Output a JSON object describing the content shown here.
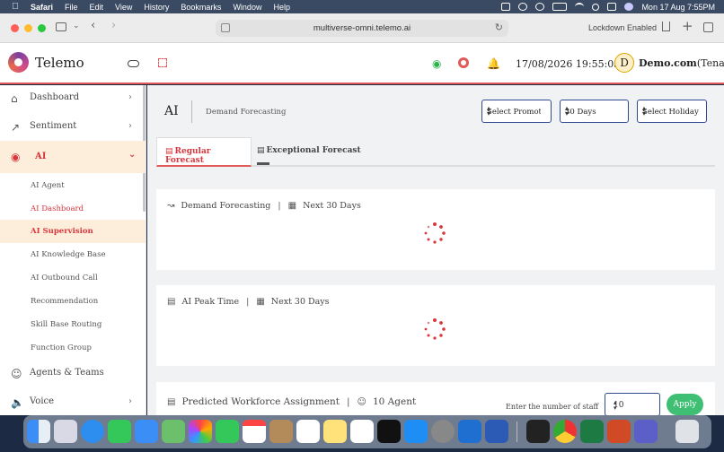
{
  "menubar": {
    "app": "Safari",
    "items": [
      "File",
      "Edit",
      "View",
      "History",
      "Bookmarks",
      "Window",
      "Help"
    ],
    "clock": "Mon 17 Aug  7:55PM"
  },
  "browser": {
    "url": "multiverse-omni.telemo.ai",
    "lockdown": "Lockdown Enabled"
  },
  "header": {
    "brand": "Telemo",
    "datetime": "17/08/2026 19:55:03",
    "avatar_initial": "D",
    "tenant_name": "Demo.com",
    "tenant_suffix": "(Tenant)"
  },
  "sidebar": {
    "dashboard": "Dashboard",
    "sentiment": "Sentiment",
    "ai": "AI",
    "ai_children": [
      "AI Agent",
      "AI Dashboard",
      "AI Supervision",
      "AI Knowledge Base",
      "AI Outbound Call",
      "Recommendation",
      "Skill Base Routing",
      "Function Group"
    ],
    "agents_teams": "Agents & Teams",
    "voice": "Voice"
  },
  "page": {
    "title": "AI",
    "subtitle": "Demand Forecasting",
    "promotion_select": "Select Promotio",
    "days_select": "30 Days",
    "holiday_select": "Select Holiday"
  },
  "tabs": {
    "regular": "Regular Forecast",
    "exceptional": "Exceptional Forecast"
  },
  "cards": {
    "demand_title": "Demand Forecasting",
    "demand_range": "Next 30 Days",
    "peak_title": "AI Peak Time",
    "peak_range": "Next 30 Days",
    "workforce_title": "Predicted Workforce Assignment",
    "workforce_agents": "10 Agent"
  },
  "staff": {
    "label": "Enter the number of staff",
    "value": "10",
    "apply": "Apply"
  },
  "colors": {
    "accent": "#d9363e",
    "active_bg": "#fdeedb",
    "apply_green": "#3fbf73",
    "select_border": "#2f4a8f"
  }
}
